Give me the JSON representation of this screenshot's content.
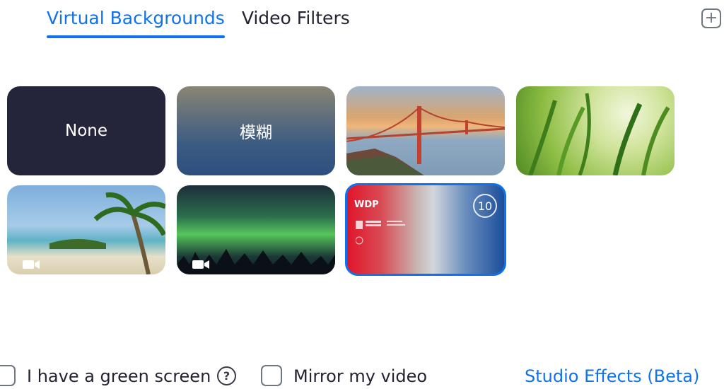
{
  "tabs": [
    {
      "label": "Virtual Backgrounds",
      "active": true
    },
    {
      "label": "Video Filters",
      "active": false
    }
  ],
  "add_icon": "plus-icon",
  "backgrounds": [
    {
      "label": "None",
      "kind": "solid"
    },
    {
      "label": "模糊",
      "kind": "blur"
    },
    {
      "label": "",
      "kind": "image-golden-gate-bridge"
    },
    {
      "label": "",
      "kind": "image-grass"
    },
    {
      "label": "",
      "kind": "video-beach",
      "icon": "video-camera-icon"
    },
    {
      "label": "",
      "kind": "video-aurora",
      "icon": "video-camera-icon"
    },
    {
      "label": "",
      "kind": "image-wdp",
      "selected": true,
      "brand_text": "WDP",
      "badge": "10"
    }
  ],
  "options": {
    "green_screen_label": "I have a green screen",
    "green_screen_checked": false,
    "help_symbol": "?",
    "mirror_label": "Mirror my video",
    "mirror_checked": false,
    "studio_effects_label": "Studio Effects (Beta)"
  },
  "colors": {
    "accent": "#0e72ed",
    "text": "#232333",
    "none_tile": "#24243a"
  }
}
